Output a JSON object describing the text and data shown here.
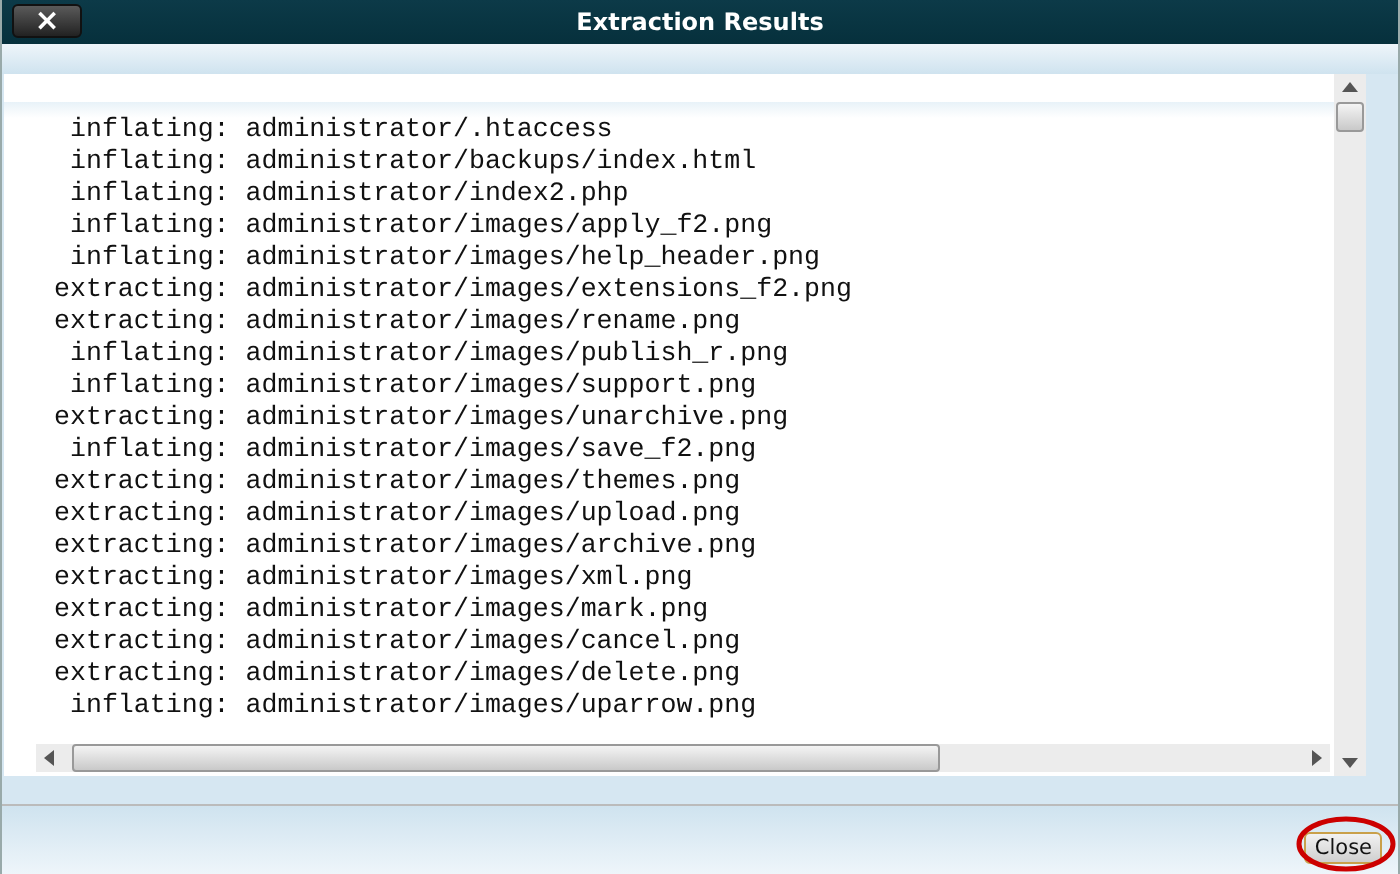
{
  "window": {
    "title": "Extraction Results",
    "close_symbol": "×"
  },
  "log_lines": [
    " inflating: administrator/.htaccess",
    " inflating: administrator/backups/index.html",
    " inflating: administrator/index2.php",
    " inflating: administrator/images/apply_f2.png",
    " inflating: administrator/images/help_header.png",
    "extracting: administrator/images/extensions_f2.png",
    "extracting: administrator/images/rename.png",
    " inflating: administrator/images/publish_r.png",
    " inflating: administrator/images/support.png",
    "extracting: administrator/images/unarchive.png",
    " inflating: administrator/images/save_f2.png",
    "extracting: administrator/images/themes.png",
    "extracting: administrator/images/upload.png",
    "extracting: administrator/images/archive.png",
    "extracting: administrator/images/xml.png",
    "extracting: administrator/images/mark.png",
    "extracting: administrator/images/cancel.png",
    "extracting: administrator/images/delete.png",
    " inflating: administrator/images/uparrow.png"
  ],
  "footer": {
    "button": "Close",
    "highlighted": true
  }
}
